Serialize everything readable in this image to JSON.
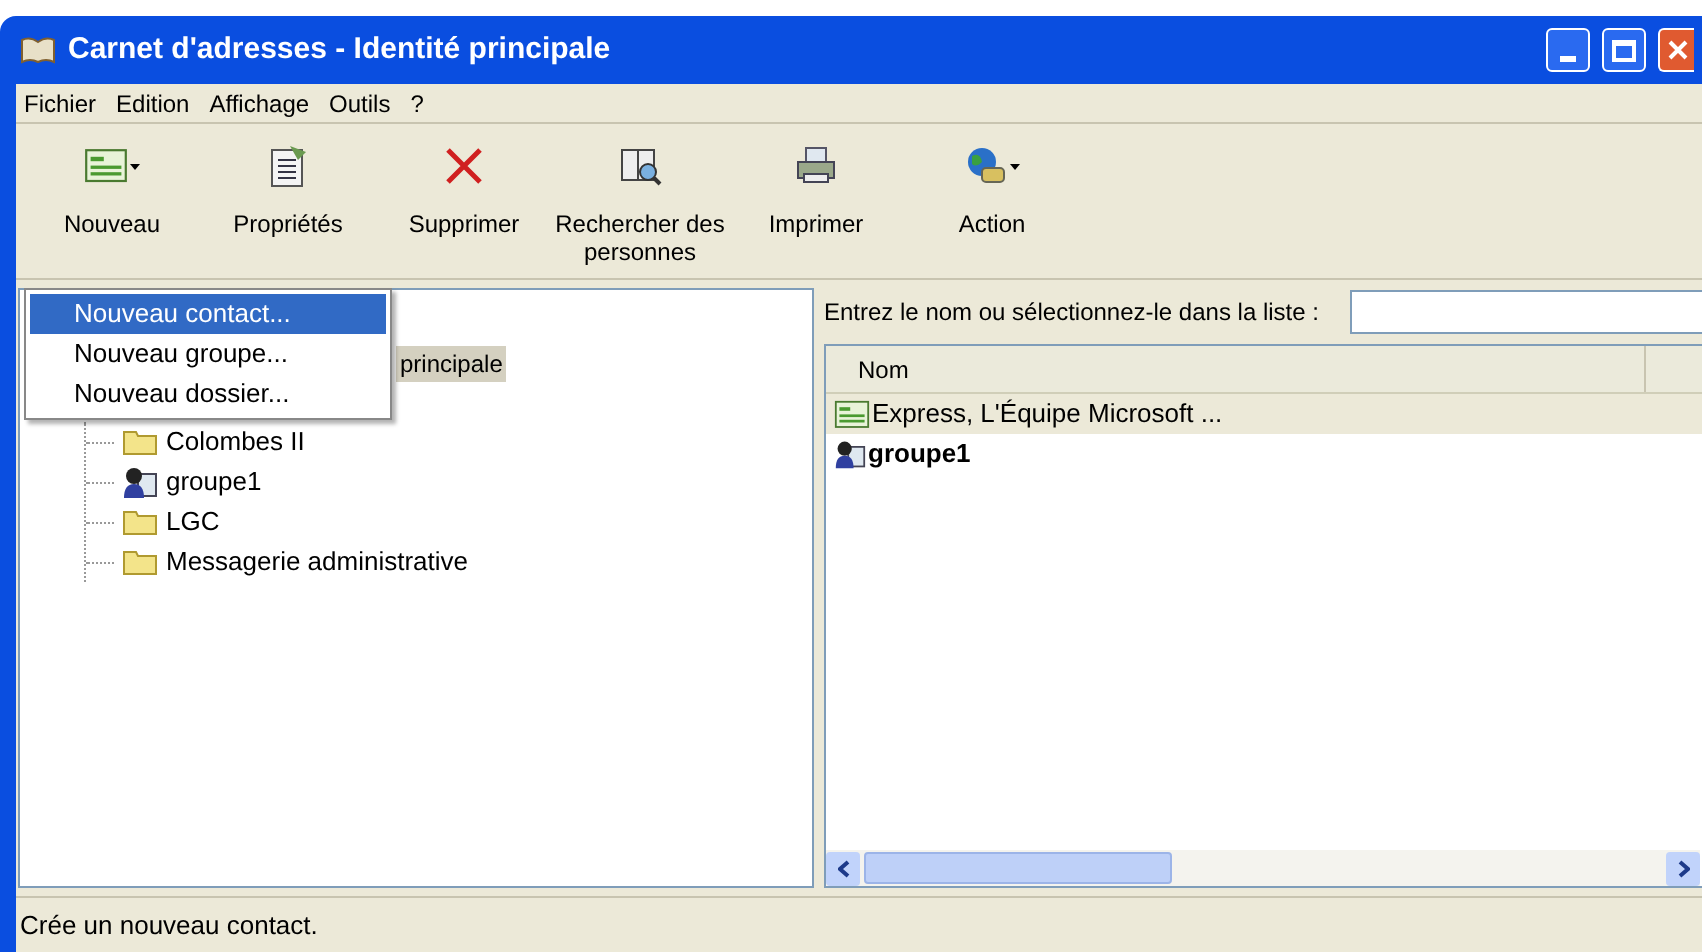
{
  "window": {
    "title": "Carnet d'adresses - Identité principale"
  },
  "menu": [
    "Fichier",
    "Edition",
    "Affichage",
    "Outils",
    "?"
  ],
  "toolbar": [
    {
      "label": "Nouveau",
      "kind": "card",
      "dropdown": true
    },
    {
      "label": "Propriétés",
      "kind": "properties",
      "dropdown": false
    },
    {
      "label": "Supprimer",
      "kind": "delete",
      "dropdown": false
    },
    {
      "label": "Rechercher des personnes",
      "kind": "search",
      "dropdown": false
    },
    {
      "label": "Imprimer",
      "kind": "print",
      "dropdown": false
    },
    {
      "label": "Action",
      "kind": "action",
      "dropdown": true
    }
  ],
  "dropdown_menu": [
    {
      "label": "Nouveau contact...",
      "selected": true
    },
    {
      "label": "Nouveau groupe...",
      "selected": false
    },
    {
      "label": "Nouveau dossier...",
      "selected": false
    }
  ],
  "tree": {
    "label": "principale",
    "selected": true,
    "children": [
      {
        "label": "Colombes II",
        "kind": "folder"
      },
      {
        "label": "groupe1",
        "kind": "group"
      },
      {
        "label": "LGC",
        "kind": "folder"
      },
      {
        "label": "Messagerie administrative",
        "kind": "folder"
      }
    ]
  },
  "search": {
    "label": "Entrez le nom ou sélectionnez-le dans la liste :"
  },
  "list": {
    "columns": [
      "Nom"
    ],
    "rows": [
      {
        "name": "Express, L'Équipe Microsoft ...",
        "kind": "contact",
        "selected": true,
        "bold": false
      },
      {
        "name": "groupe1",
        "kind": "group",
        "selected": false,
        "bold": true
      }
    ]
  },
  "status_bar": "Crée un nouveau contact."
}
